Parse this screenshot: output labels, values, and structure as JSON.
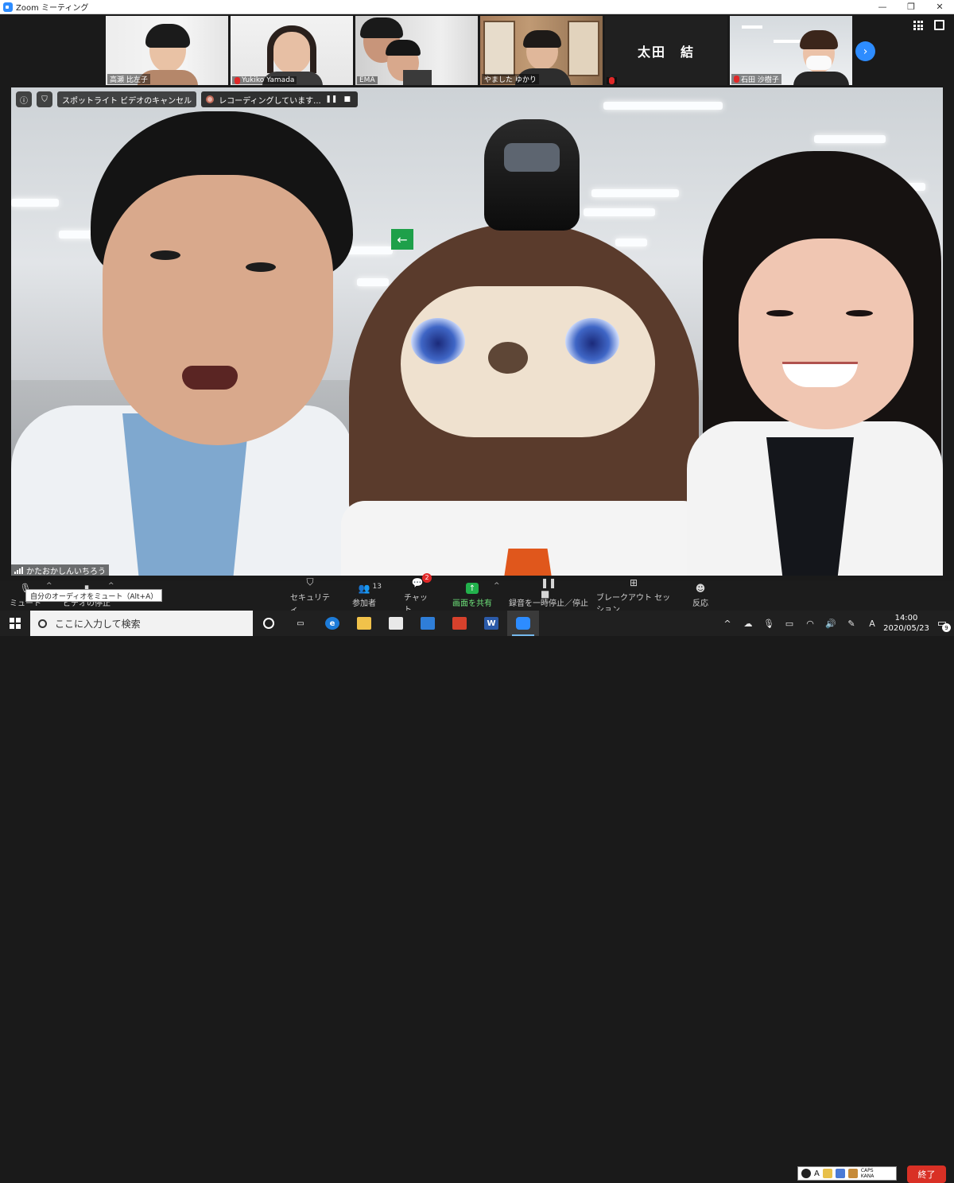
{
  "window": {
    "title": "Zoom ミーティング",
    "minimize": "—",
    "restore": "❐",
    "close": "✕"
  },
  "participants": [
    {
      "name": "高瀬 比左子",
      "muted": false
    },
    {
      "name": "Yukiko Yamada",
      "muted": true
    },
    {
      "name": "EMA",
      "muted": false
    },
    {
      "name": "やました ゆかり",
      "muted": false
    },
    {
      "name": "太田　結",
      "muted": true,
      "video_off": true
    },
    {
      "name": "石田 沙樹子",
      "muted": true
    }
  ],
  "next_icon": "›",
  "spotlight": {
    "info_icon": "ⓘ",
    "shield_icon": "⛉",
    "cancel_label": "スポットライト ビデオのキャンセル",
    "recording_label": "レコーディングしています...",
    "pause_icon": "❚❚",
    "stop_icon": "■"
  },
  "speaker_name": "かたおかしんいちろう",
  "toolbar": {
    "mute_label": "ミュート",
    "video_label": "ビデオの停止",
    "mute_tooltip": "自分のオーディオをミュート（Alt+A）",
    "security_label": "セキュリティ",
    "participants_label": "参加者",
    "participants_count": "13",
    "chat_label": "チャット",
    "chat_badge": "2",
    "share_label": "画面を共有",
    "share_icon": "↑",
    "record_label": "録音を一時停止／停止",
    "breakout_label": "ブレークアウト セッション",
    "reactions_label": "反応",
    "end_label": "終了",
    "caret": "^"
  },
  "ime": {
    "caps": "CAPS",
    "kana": "KANA",
    "letter": "A"
  },
  "taskbar": {
    "search_placeholder": "ここに入力して検索",
    "time": "14:00",
    "date": "2020/05/23",
    "ime_letter": "A",
    "notification_count": "9"
  },
  "colors": {
    "accent": "#2d8cff",
    "end": "#d93025",
    "share": "#22b14c",
    "muted": "#e02828"
  }
}
